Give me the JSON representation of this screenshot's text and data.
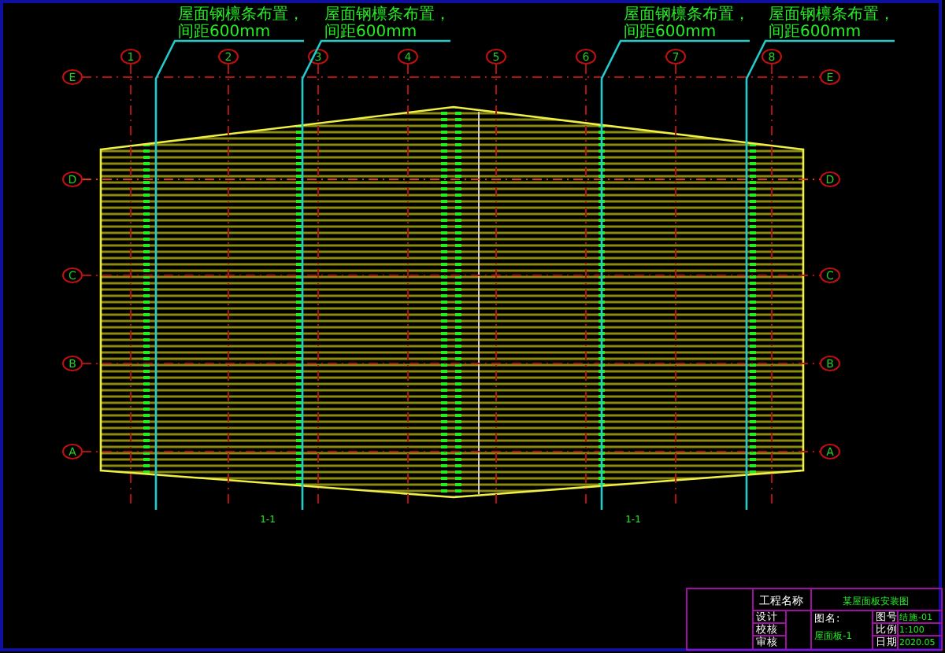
{
  "grid": {
    "columns": [
      "1",
      "2",
      "3",
      "4",
      "5",
      "6",
      "7",
      "8"
    ],
    "rows": [
      {
        "left": "E",
        "right": "E"
      },
      {
        "left": "D",
        "right": "D"
      },
      {
        "left": "C",
        "right": "C"
      },
      {
        "left": "B",
        "right": "B"
      },
      {
        "left": "A",
        "right": "A"
      }
    ]
  },
  "leaders": [
    {
      "line_1": "屋面钢檩条布置，",
      "line_2": "间距600mm"
    },
    {
      "line_1": "屋面钢檩条布置，",
      "line_2": "间距600mm"
    },
    {
      "line_1": "屋面钢檩条布置，",
      "line_2": "间距600mm"
    },
    {
      "line_1": "屋面钢檩条布置，",
      "line_2": "间距600mm"
    }
  ],
  "section_marks": [
    "1-1",
    "1-1"
  ],
  "title_block": {
    "project_label": "工程名称",
    "project_name": "某屋面板安装图",
    "drawing_label": "图名:",
    "drawing_name": "屋面板-1",
    "rows": [
      {
        "label": "设计",
        "key": "图号",
        "value": "结施-01"
      },
      {
        "label": "校核",
        "key": "比例",
        "value": "1:100"
      },
      {
        "label": "审核",
        "key": "日期",
        "value": "2020.05"
      }
    ]
  }
}
